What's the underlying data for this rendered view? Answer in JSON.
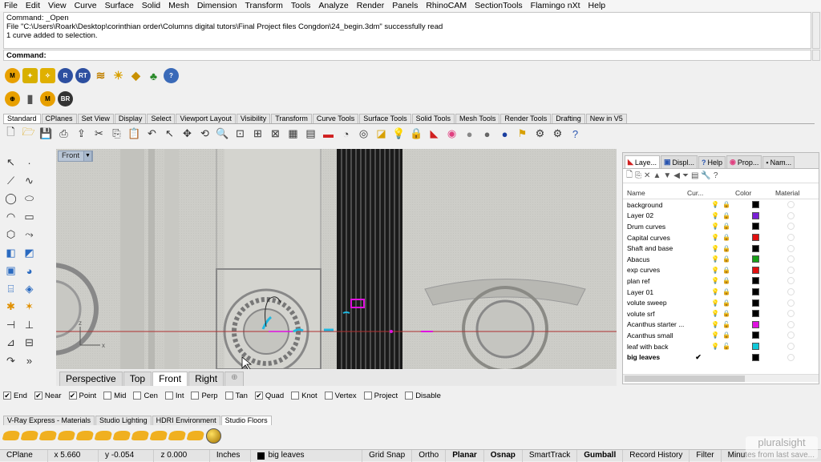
{
  "menu": [
    "File",
    "Edit",
    "View",
    "Curve",
    "Surface",
    "Solid",
    "Mesh",
    "Dimension",
    "Transform",
    "Tools",
    "Analyze",
    "Render",
    "Panels",
    "RhinoCAM",
    "SectionTools",
    "Flamingo nXt",
    "Help"
  ],
  "history": [
    "Command: _Open",
    "File \"C:\\Users\\Roark\\Desktop\\corinthian order\\Columns digital tutors\\Final Project files Congdon\\24_begin.3dm\" successfully read",
    "1 curve added to selection."
  ],
  "command_label": "Command:",
  "plugin_row1": [
    "M",
    "RT",
    "R"
  ],
  "plugin_row2": [
    "M",
    "BR"
  ],
  "tabs": [
    "Standard",
    "CPlanes",
    "Set View",
    "Display",
    "Select",
    "Viewport Layout",
    "Visibility",
    "Transform",
    "Curve Tools",
    "Surface Tools",
    "Solid Tools",
    "Mesh Tools",
    "Render Tools",
    "Drafting",
    "New in V5"
  ],
  "viewport": {
    "label": "Front"
  },
  "viewport_tabs": [
    "Perspective",
    "Top",
    "Front",
    "Right"
  ],
  "panel": {
    "tabs": [
      "Laye...",
      "Displ...",
      "Help",
      "Prop...",
      "Nam..."
    ],
    "headers": {
      "name": "Name",
      "current": "Cur...",
      "color": "Color",
      "material": "Material"
    },
    "layers": [
      {
        "name": "background",
        "color": "#000000",
        "current": ""
      },
      {
        "name": "Layer 02",
        "color": "#7a1fd6",
        "current": ""
      },
      {
        "name": "Drum curves",
        "color": "#000000",
        "current": ""
      },
      {
        "name": "Capital curves",
        "color": "#e01010",
        "current": ""
      },
      {
        "name": "Shaft and base",
        "color": "#000000",
        "current": ""
      },
      {
        "name": "Abacus",
        "color": "#18a018",
        "current": ""
      },
      {
        "name": "exp curves",
        "color": "#e01010",
        "current": ""
      },
      {
        "name": "plan ref",
        "color": "#000000",
        "current": ""
      },
      {
        "name": "Layer 01",
        "color": "#000000",
        "current": ""
      },
      {
        "name": "volute sweep",
        "color": "#000000",
        "current": ""
      },
      {
        "name": "volute srf",
        "color": "#000000",
        "current": ""
      },
      {
        "name": "Acanthus starter ...",
        "color": "#e010e0",
        "current": ""
      },
      {
        "name": "Acanthus small",
        "color": "#000000",
        "current": ""
      },
      {
        "name": "leaf with back",
        "color": "#10c8d8",
        "current": ""
      },
      {
        "name": "big leaves",
        "color": "#000000",
        "current": "✔"
      }
    ]
  },
  "osnap": [
    {
      "label": "End",
      "checked": true
    },
    {
      "label": "Near",
      "checked": true
    },
    {
      "label": "Point",
      "checked": true
    },
    {
      "label": "Mid",
      "checked": false
    },
    {
      "label": "Cen",
      "checked": false
    },
    {
      "label": "Int",
      "checked": false
    },
    {
      "label": "Perp",
      "checked": false
    },
    {
      "label": "Tan",
      "checked": false
    },
    {
      "label": "Quad",
      "checked": true
    },
    {
      "label": "Knot",
      "checked": false
    },
    {
      "label": "Vertex",
      "checked": false
    },
    {
      "label": "Project",
      "checked": false
    },
    {
      "label": "Disable",
      "checked": false
    }
  ],
  "bottom_tabs": [
    "V-Ray Express - Materials",
    "Studio Lighting",
    "HDRI Environment",
    "Studio Floors"
  ],
  "status": {
    "cplane": "CPlane",
    "x": "x 5.660",
    "y": "y -0.054",
    "z": "z 0.000",
    "units": "Inches",
    "layer": "big leaves",
    "grid_snap": "Grid Snap",
    "ortho": "Ortho",
    "planar": "Planar",
    "osnap": "Osnap",
    "smarttrack": "SmartTrack",
    "gumball": "Gumball",
    "record_history": "Record History",
    "filter": "Filter",
    "minutes": "Minutes from last save..."
  },
  "watermark": "pluralsight"
}
